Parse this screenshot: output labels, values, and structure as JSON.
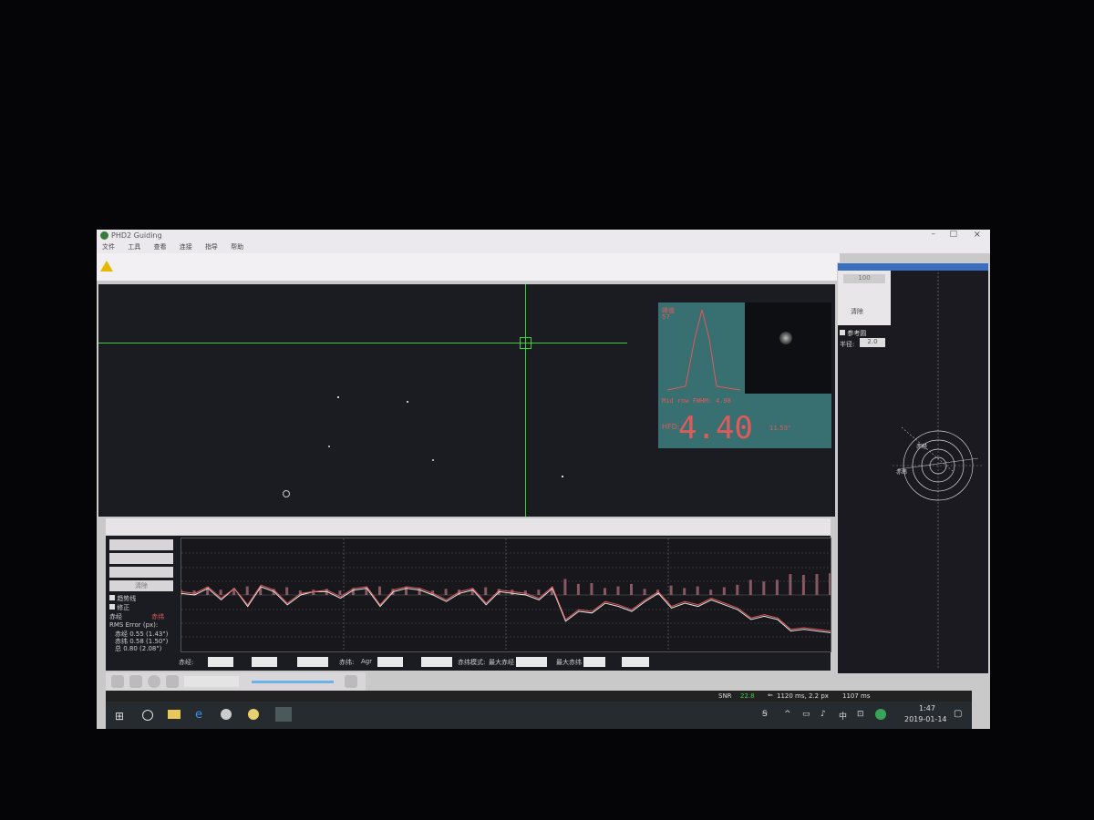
{
  "window": {
    "title": "PHD2 Guiding",
    "menu": [
      "文件",
      "工具",
      "查看",
      "连接",
      "指导",
      "帮助"
    ]
  },
  "alert": {
    "text": ""
  },
  "hfd_panel": {
    "peak_label": "峰值",
    "peak_value": "57",
    "fwhm_label": "Mid row FWHM: 4.98",
    "hfd_label": "HFD:",
    "hfd_value": "4.40",
    "hfd_arcsec": "11.53\""
  },
  "graph": {
    "controls": [
      "清除",
      "趋势线",
      "修正"
    ],
    "rms_title": "RMS Error (px):",
    "rms_ra": "赤经 0.55 (1.43\")",
    "rms_dec": "赤纬 0.58 (1.50\")",
    "rms_tot": "总 0.80 (2.08\")",
    "ra_label": "赤经",
    "dec_label": "赤纬"
  },
  "params": {
    "ra_label": "赤经:",
    "agr_label": "Agr",
    "dec_label": "赤纬:",
    "max_ra_label": "最大赤经",
    "max_dec_label": "最大赤纬",
    "guide_label": "赤纬模式:"
  },
  "target": {
    "zoom": "100",
    "clear_label": "清除",
    "ref_circle_label": "参考圆",
    "radius_label": "半径:",
    "radius_value": "2.0",
    "ra_axis": "赤经",
    "dec_axis": "赤纬"
  },
  "status": {
    "snr_label": "SNR",
    "snr_value": "22.8",
    "exposure": "1120 ms, 2.2 px",
    "frame": "1107 ms"
  },
  "taskbar": {
    "time": "1:47",
    "date": "2019-01-14"
  },
  "colors": {
    "ra": "#e05a5a",
    "dec": "#e8e8e8",
    "guide_line": "#3bd13b",
    "hfd_bg": "#386f71"
  },
  "chart_data": {
    "type": "line",
    "series": [
      {
        "name": "赤经",
        "values": [
          0.2,
          0.1,
          0.5,
          -0.2,
          0.4,
          -0.6,
          0.6,
          0.3,
          -0.5,
          0.1,
          0.2,
          0.3,
          -0.1,
          0.4,
          0.5,
          -0.6,
          0.3,
          0.5,
          0.4,
          0.1,
          -0.3,
          0.2,
          0.4,
          -0.5,
          0.3,
          0.2,
          0.1,
          -0.2,
          0.5,
          -1.5,
          -0.9,
          -1.0,
          -0.4,
          -0.6,
          -0.9,
          -0.3,
          0.2,
          -0.7,
          -0.4,
          -0.6,
          -0.2,
          -0.5,
          -0.8,
          -1.4,
          -1.2,
          -1.4,
          -2.1,
          -2.0,
          -2.1,
          -2.2
        ]
      },
      {
        "name": "赤纬",
        "values": [
          0.1,
          0.0,
          0.4,
          -0.3,
          0.4,
          -0.7,
          0.5,
          0.2,
          -0.6,
          0.0,
          0.2,
          0.2,
          -0.2,
          0.3,
          0.4,
          -0.7,
          0.2,
          0.4,
          0.3,
          0.0,
          -0.4,
          0.1,
          0.3,
          -0.6,
          0.2,
          0.1,
          0.0,
          -0.3,
          0.4,
          -1.6,
          -1.0,
          -1.1,
          -0.5,
          -0.7,
          -1.0,
          -0.4,
          0.1,
          -0.8,
          -0.5,
          -0.7,
          -0.3,
          -0.6,
          -0.9,
          -1.5,
          -1.3,
          -1.5,
          -2.2,
          -2.1,
          -2.2,
          -2.3
        ]
      }
    ]
  }
}
